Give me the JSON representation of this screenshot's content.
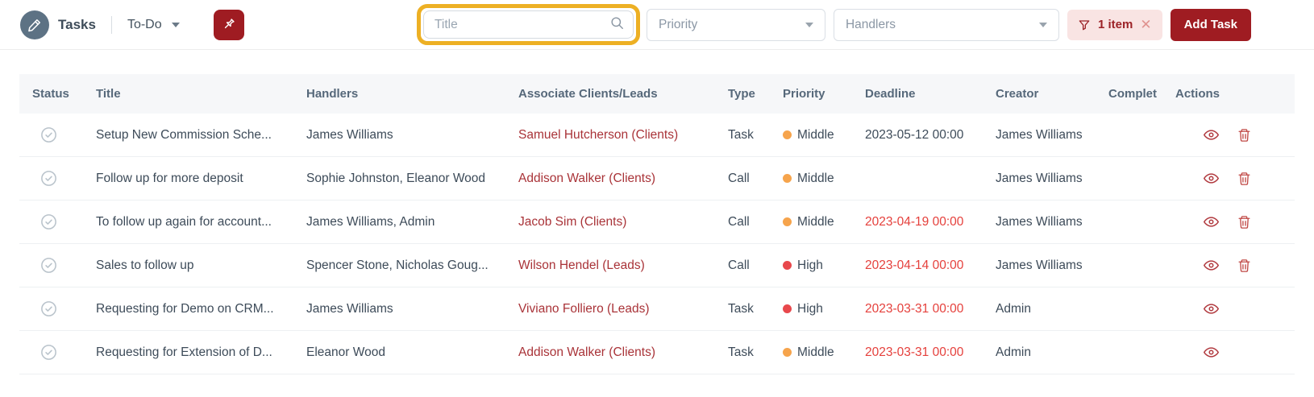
{
  "topbar": {
    "app_title": "Tasks",
    "view_label": "To-Do",
    "search": {
      "placeholder": "Title"
    },
    "priority_filter": {
      "placeholder": "Priority"
    },
    "handlers_filter": {
      "placeholder": "Handlers"
    },
    "filter_badge": {
      "label": "1 item",
      "close_glyph": "✕"
    },
    "add_task_label": "Add Task"
  },
  "table": {
    "columns": [
      "Status",
      "Title",
      "Handlers",
      "Associate Clients/Leads",
      "Type",
      "Priority",
      "Deadline",
      "Creator",
      "Complet",
      "Actions"
    ],
    "rows": [
      {
        "title": "Setup New Commission Sche...",
        "handlers": "James Williams",
        "associate": "Samuel Hutcherson (Clients)",
        "type": "Task",
        "priority": "Middle",
        "priority_level": "middle",
        "deadline": "2023-05-12 00:00",
        "deadline_overdue": false,
        "creator": "James Williams",
        "completed": "",
        "actions": [
          "view",
          "delete"
        ]
      },
      {
        "title": "Follow up for more deposit",
        "handlers": "Sophie Johnston, Eleanor Wood",
        "associate": "Addison Walker (Clients)",
        "type": "Call",
        "priority": "Middle",
        "priority_level": "middle",
        "deadline": "",
        "deadline_overdue": false,
        "creator": "James Williams",
        "completed": "",
        "actions": [
          "view",
          "delete"
        ]
      },
      {
        "title": "To follow up again for account...",
        "handlers": "James Williams, Admin",
        "associate": "Jacob Sim (Clients)",
        "type": "Call",
        "priority": "Middle",
        "priority_level": "middle",
        "deadline": "2023-04-19 00:00",
        "deadline_overdue": true,
        "creator": "James Williams",
        "completed": "",
        "actions": [
          "view",
          "delete"
        ]
      },
      {
        "title": "Sales to follow up",
        "handlers": "Spencer Stone, Nicholas Goug...",
        "associate": "Wilson Hendel (Leads)",
        "type": "Call",
        "priority": "High",
        "priority_level": "high",
        "deadline": "2023-04-14 00:00",
        "deadline_overdue": true,
        "creator": "James Williams",
        "completed": "",
        "actions": [
          "view",
          "delete"
        ]
      },
      {
        "title": "Requesting for Demo on CRM...",
        "handlers": "James Williams",
        "associate": "Viviano Folliero (Leads)",
        "type": "Task",
        "priority": "High",
        "priority_level": "high",
        "deadline": "2023-03-31 00:00",
        "deadline_overdue": true,
        "creator": "Admin",
        "completed": "",
        "actions": [
          "view"
        ]
      },
      {
        "title": "Requesting for Extension of D...",
        "handlers": "Eleanor Wood",
        "associate": "Addison Walker (Clients)",
        "type": "Task",
        "priority": "Middle",
        "priority_level": "middle",
        "deadline": "2023-03-31 00:00",
        "deadline_overdue": true,
        "creator": "Admin",
        "completed": "",
        "actions": [
          "view"
        ]
      }
    ]
  },
  "colors": {
    "brand_red": "#9f1c22",
    "link_red": "#a93338",
    "overdue_red": "#e5403c",
    "priority_middle": "#f6a44c",
    "priority_high": "#e8484c",
    "search_highlight_gold": "#edb024",
    "filter_badge_bg": "#f9e4e3"
  }
}
